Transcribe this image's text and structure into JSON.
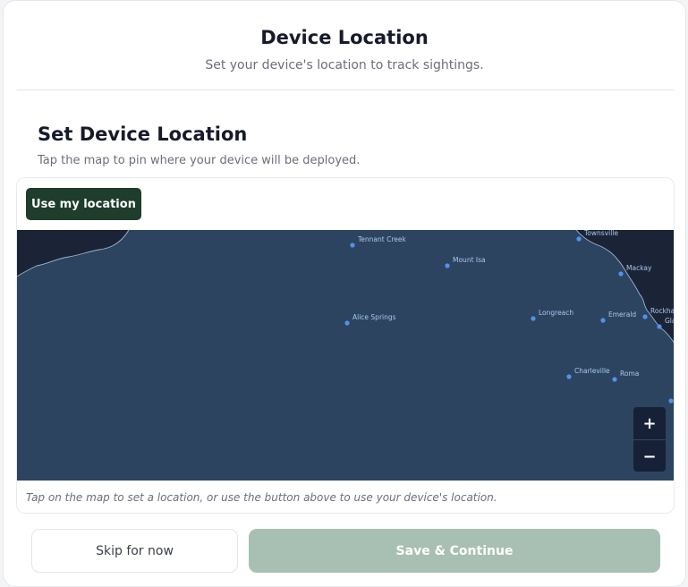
{
  "header": {
    "title": "Device Location",
    "subtitle": "Set your device's location to track sightings."
  },
  "section": {
    "title": "Set Device Location",
    "description": "Tap the map to pin where your device will be deployed."
  },
  "map": {
    "use_location_label": "Use my location",
    "zoom_in_label": "+",
    "zoom_out_label": "−",
    "hint": "Tap on the map to set a location, or use the button above to use your device's location.",
    "cities": [
      "Tennant Creek",
      "Mount Isa",
      "Townsville",
      "Mackay",
      "Alice Springs",
      "Longreach",
      "Emerald",
      "Rockhampton",
      "Gladstone",
      "Charleville",
      "Roma"
    ],
    "colors": {
      "land": "#2d4460",
      "sea": "#1b2436",
      "coast": "#9eb3cc",
      "city_dot": "#4f93f0"
    }
  },
  "actions": {
    "skip_label": "Skip for now",
    "save_label": "Save & Continue"
  },
  "colors": {
    "primary": "#1e3d2c",
    "primary_disabled": "#a8c0b4"
  }
}
